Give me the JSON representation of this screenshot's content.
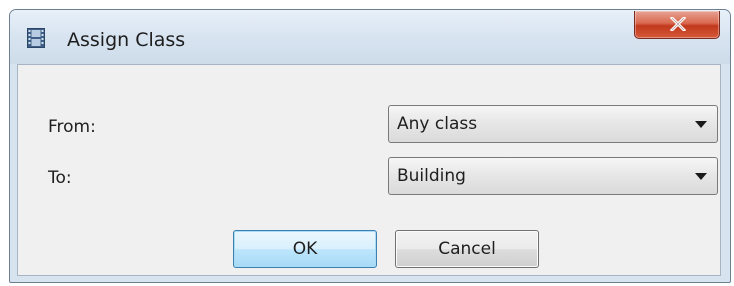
{
  "window": {
    "title": "Assign Class",
    "title_icon": "film-strip-icon",
    "close_icon": "close-icon"
  },
  "form": {
    "from_label": "From:",
    "from_value": "Any class",
    "to_label": "To:",
    "to_value": "Building"
  },
  "buttons": {
    "ok_label": "OK",
    "cancel_label": "Cancel"
  },
  "colors": {
    "close_button": "#c7432a",
    "ok_button_border": "#3c7fb1"
  }
}
